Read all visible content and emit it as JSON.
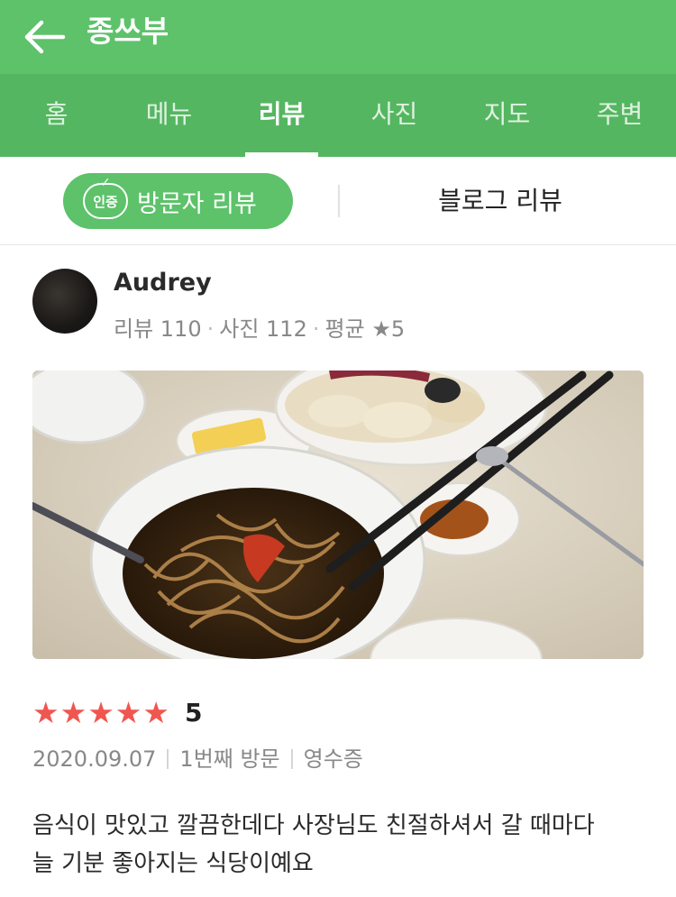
{
  "header": {
    "title": "종쓰부"
  },
  "tabs": [
    {
      "label": "홈"
    },
    {
      "label": "메뉴"
    },
    {
      "label": "리뷰"
    },
    {
      "label": "사진"
    },
    {
      "label": "지도"
    },
    {
      "label": "주변"
    }
  ],
  "active_tab": "리뷰",
  "subtabs": {
    "visitor_badge": "인증",
    "visitor_label": "방문자 리뷰",
    "blog_label": "블로그 리뷰"
  },
  "review": {
    "user": {
      "name": "Audrey",
      "reviews": "리뷰 110",
      "photos": "사진 112",
      "average_label": "평균",
      "average_value": "5"
    },
    "rating_stars": 5,
    "rating_value": "5",
    "date": "2020.09.07",
    "visit": "1번째 방문",
    "receipt": "영수증",
    "text_line1": "음식이 맛있고 깔끔한데다 사장님도 친절하셔서 갈 때마다",
    "text_line2": "늘 기분 좋아지는 식당이예요"
  },
  "colors": {
    "brand_green": "#5dc26a",
    "tab_green": "#55b661",
    "star_red": "#f05650"
  },
  "icons": {
    "back": "back-arrow-icon",
    "star": "star-icon",
    "certified": "certified-badge-icon"
  }
}
